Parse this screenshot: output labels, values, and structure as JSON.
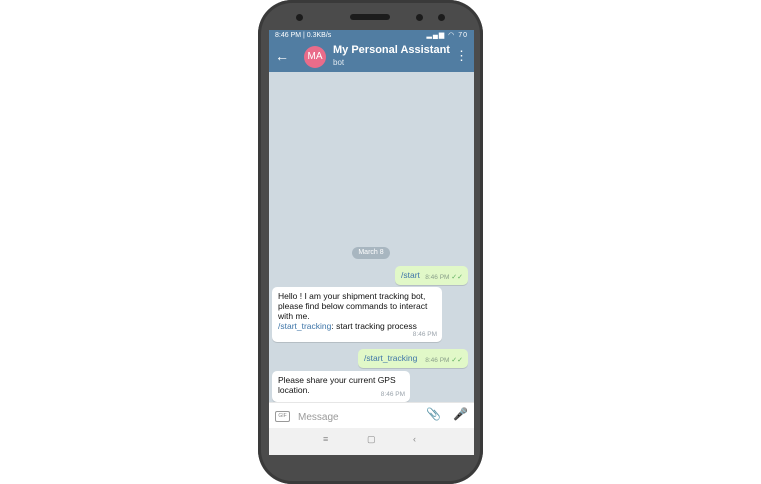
{
  "status_bar": {
    "time_speed": "8:46 PM | 0.3KB/s",
    "indicators": "▂▄▆ ◠ 70"
  },
  "header": {
    "back_icon": "←",
    "avatar_initials": "MA",
    "title": "My Personal Assistant",
    "subtitle": "bot",
    "menu_icon": "⋮"
  },
  "chat": {
    "date_label": "March 8",
    "messages": [
      {
        "direction": "out",
        "command": "/start",
        "time": "8:46 PM",
        "check": "✓✓"
      },
      {
        "direction": "in",
        "text": "Hello ! I am your shipment tracking bot, please find below commands to interact with me.",
        "command": "/start_tracking",
        "command_desc": ": start tracking process",
        "time": "8:46 PM"
      },
      {
        "direction": "out",
        "command": "/start_tracking",
        "time": "8:46 PM",
        "check": "✓✓"
      },
      {
        "direction": "in",
        "text": "Please share your current GPS location.",
        "time": "8:46 PM"
      }
    ]
  },
  "input": {
    "gif_label": "GIF",
    "placeholder": "Message",
    "attach_icon": "📎",
    "mic_icon": "🎤"
  },
  "nav": {
    "menu": "≡",
    "home": "▢",
    "back": "‹"
  }
}
